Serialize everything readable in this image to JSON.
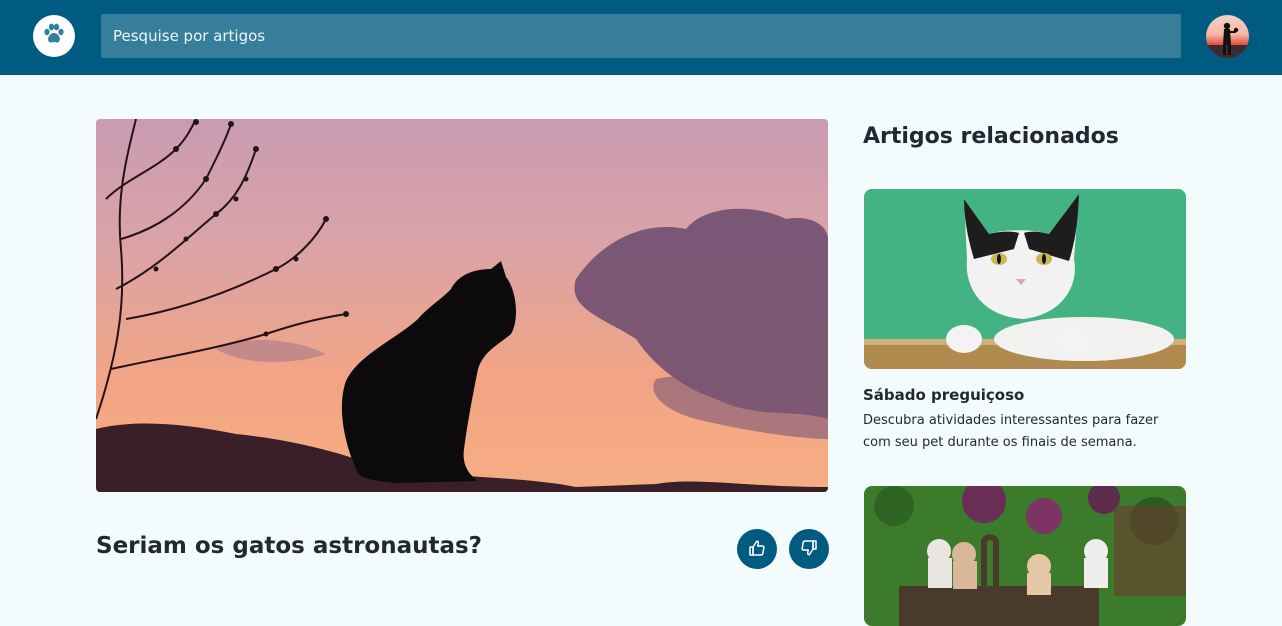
{
  "header": {
    "logo_icon": "paw-icon",
    "search_placeholder": "Pesquise por artigos",
    "avatar": "user-avatar",
    "brand_color": "#005b80"
  },
  "article": {
    "title": "Seriam os gatos astronautas?",
    "like_icon": "thumbs-up-icon",
    "dislike_icon": "thumbs-down-icon"
  },
  "related": {
    "heading": "Artigos relacionados",
    "items": [
      {
        "title": "Sábado preguiçoso",
        "description": "Descubra atividades interessantes para fazer com seu pet durante os finais de semana."
      },
      {
        "title": "",
        "description": ""
      }
    ]
  }
}
